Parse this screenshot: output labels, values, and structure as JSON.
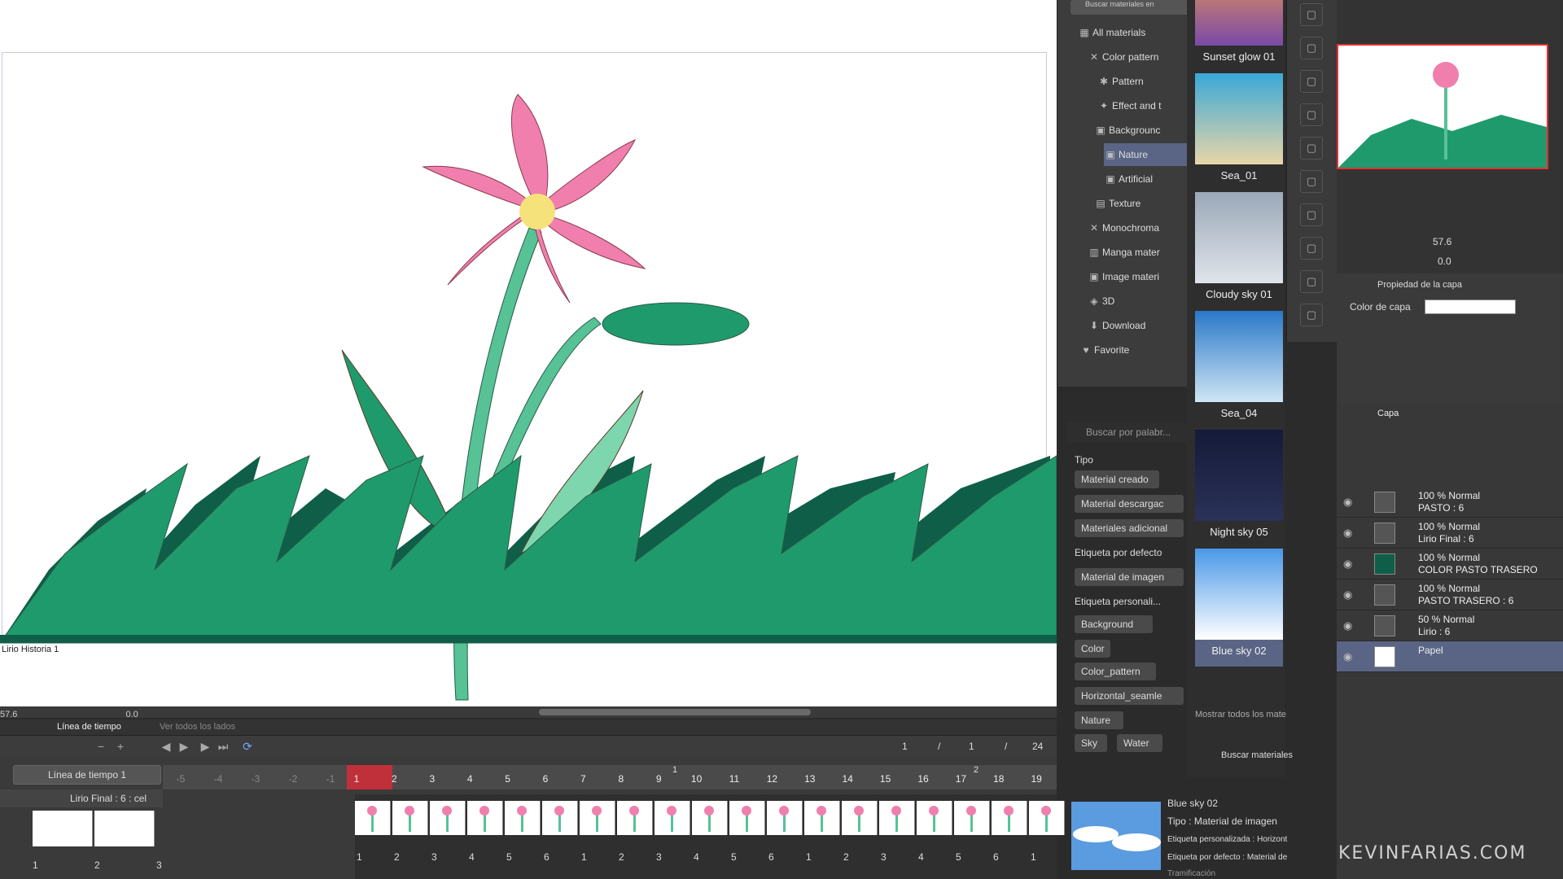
{
  "canvas": {
    "label": "Lirio Historia 1",
    "zoom": "57.6",
    "angle": "0.0"
  },
  "timeline": {
    "tab_active": "Línea de tiempo",
    "tab_other": "Ver todos los lados",
    "selector": "Línea de tiempo 1",
    "track_name": "Lirio Final : 6 : cel",
    "frame_current": "1",
    "frame_sep1": "/",
    "frame_start": "1",
    "frame_sep2": "/",
    "frame_total": "24",
    "ruler": [
      "-5",
      "-4",
      "-3",
      "-2",
      "-1",
      "1",
      "2",
      "3",
      "4",
      "5",
      "6",
      "7",
      "8",
      "9",
      "10",
      "11",
      "12",
      "13",
      "14",
      "15",
      "16",
      "17",
      "18",
      "19"
    ],
    "ruler_top_1": "1",
    "ruler_top_2": "2",
    "cel_numbers": [
      "1",
      "2",
      "3",
      "4",
      "5",
      "6",
      "1",
      "2",
      "3",
      "4",
      "5",
      "6",
      "1",
      "2",
      "3",
      "4",
      "5",
      "6",
      "1"
    ],
    "thumb_numbers": [
      "1",
      "2",
      "3"
    ]
  },
  "materials": {
    "search_top": "Buscar materiales en",
    "tree": [
      {
        "label": "All materials",
        "icon": "grid-icon"
      },
      {
        "label": "Color pattern",
        "icon": "cross-icon"
      },
      {
        "label": "Pattern",
        "icon": "pattern-icon"
      },
      {
        "label": "Effect and t",
        "icon": "effect-icon"
      },
      {
        "label": "Backgrounc",
        "icon": "image-icon"
      },
      {
        "label": "Nature",
        "icon": "image-icon"
      },
      {
        "label": "Artificial",
        "icon": "image-icon"
      },
      {
        "label": "Texture",
        "icon": "texture-icon"
      },
      {
        "label": "Monochroma",
        "icon": "cross-icon"
      },
      {
        "label": "Manga mater",
        "icon": "manga-icon"
      },
      {
        "label": "Image materi",
        "icon": "image-icon"
      },
      {
        "label": "3D",
        "icon": "3d-icon"
      },
      {
        "label": "Download",
        "icon": "download-icon"
      },
      {
        "label": "Favorite",
        "icon": "heart-icon"
      }
    ],
    "search_placeholder": "Buscar por palabr...",
    "tipo_head": "Tipo",
    "tipo": [
      "Material creado",
      "Material descargac",
      "Materiales adicional"
    ],
    "etiqueta_defecto_head": "Etiqueta por defecto",
    "etiqueta_defecto": [
      "Material de imagen"
    ],
    "etiqueta_personal_head": "Etiqueta personali...",
    "tags": [
      "Background",
      "Color",
      "Color_pattern",
      "Horizontal_seamle",
      "Nature",
      "Sky",
      "Water"
    ],
    "items": [
      {
        "name": "Sunset glow 01"
      },
      {
        "name": "Sea_01"
      },
      {
        "name": "Cloudy sky 01"
      },
      {
        "name": "Sea_04"
      },
      {
        "name": "Night sky 05"
      },
      {
        "name": "Blue sky 02"
      }
    ],
    "show_all": "Mostrar todos los mate",
    "search_materials": "Buscar materiales",
    "detail_name": "Blue sky 02",
    "detail_type": "Tipo : Material de imagen",
    "detail_tag_custom": "Etiqueta personalizada : Horizont",
    "detail_tag_default": "Etiqueta por defecto : Material de",
    "detail_extra": "Tramificación"
  },
  "navigator": {
    "zoom": "57.6",
    "angle": "0.0"
  },
  "layer_props": {
    "title": "Propiedad de la capa",
    "color_label": "Color de capa"
  },
  "layers": {
    "tab": "Capa",
    "rows": [
      {
        "mode": "100 % Normal",
        "name": "PASTO : 6"
      },
      {
        "mode": "100 % Normal",
        "name": "Lirio Final : 6"
      },
      {
        "mode": "100 % Normal",
        "name": "COLOR PASTO TRASERO"
      },
      {
        "mode": "100 % Normal",
        "name": "PASTO TRASERO : 6"
      },
      {
        "mode": "50 % Normal",
        "name": "Lirio : 6"
      },
      {
        "mode": "",
        "name": "Papel"
      }
    ]
  },
  "watermark": "KEVINFARIAS.COM",
  "colors": {
    "accent": "#5a6585",
    "grass": "#1f9a6c",
    "grass_dark": "#0f5e48",
    "petal": "#f07fae"
  }
}
